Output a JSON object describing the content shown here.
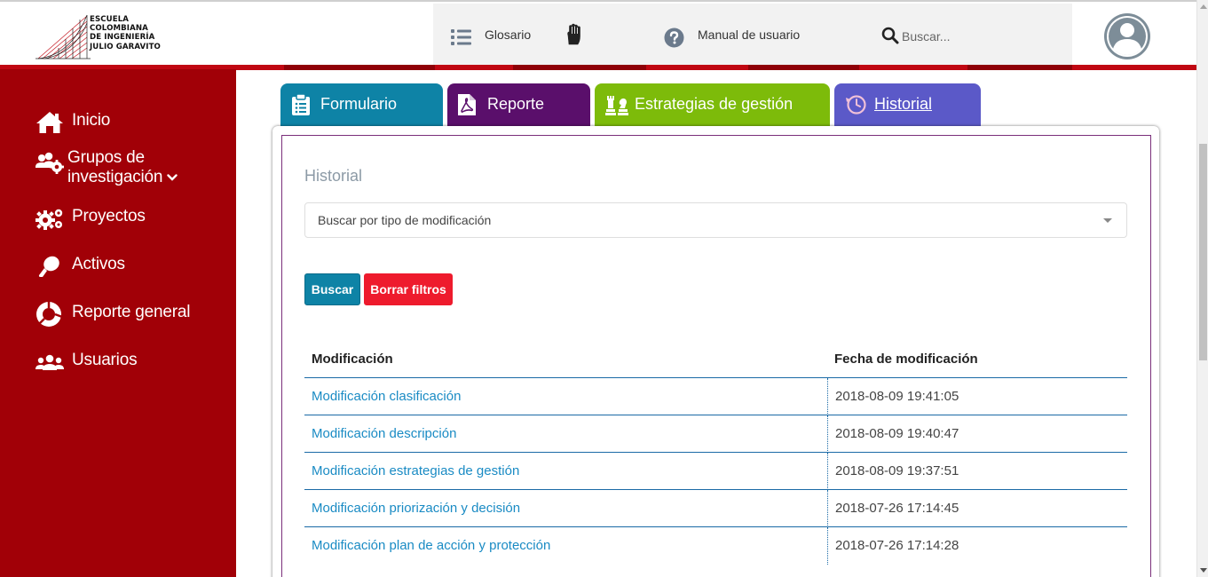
{
  "header": {
    "logo_lines": [
      "Escuela",
      "Colombiana",
      "de Ingeniería",
      "Julio Garavito"
    ],
    "glosario_label": "Glosario",
    "manual_label": "Manual de usuario",
    "search_placeholder": "Buscar..."
  },
  "sidebar": {
    "items": [
      {
        "label": "Inicio",
        "icon": "home-icon"
      },
      {
        "label": "Grupos de investigación",
        "label_line1": "Grupos de",
        "label_line2": "investigación",
        "icon": "users-gear-icon",
        "expandable": true
      },
      {
        "label": "Proyectos",
        "icon": "gears-icon"
      },
      {
        "label": "Activos",
        "icon": "asset-icon"
      },
      {
        "label": "Reporte general",
        "icon": "pie-chart-icon"
      },
      {
        "label": "Usuarios",
        "icon": "users-icon"
      }
    ]
  },
  "tabs": [
    {
      "label": "Formulario",
      "icon": "clipboard-icon",
      "color": "#0e83a6"
    },
    {
      "label": "Reporte",
      "icon": "pdf-icon",
      "color": "#5a0f6b"
    },
    {
      "label": "Estrategias de gestión",
      "icon": "chess-icon",
      "color": "#7dbb0a"
    },
    {
      "label": "Historial",
      "icon": "history-icon",
      "color": "#5b59c8",
      "active": true
    }
  ],
  "main": {
    "title": "Historial",
    "filter_placeholder": "Buscar por tipo de modificación",
    "buscar_label": "Buscar",
    "borrar_label": "Borrar filtros",
    "table": {
      "headers": [
        "Modificación",
        "Fecha de modificación"
      ],
      "rows": [
        {
          "modificacion": "Modificación clasificación",
          "fecha": "2018-08-09 19:41:05"
        },
        {
          "modificacion": "Modificación descripción",
          "fecha": "2018-08-09 19:40:47"
        },
        {
          "modificacion": "Modificación estrategias de gestión",
          "fecha": "2018-08-09 19:37:51"
        },
        {
          "modificacion": "Modificación priorización y decisión",
          "fecha": "2018-07-26 17:14:45"
        },
        {
          "modificacion": "Modificación plan de acción y protección",
          "fecha": "2018-07-26 17:14:28"
        }
      ]
    }
  },
  "colors": {
    "sidebar_bg": "#a10007",
    "accent_red": "#c00712",
    "link_blue": "#1a8bc4",
    "buscar_btn": "#0e83a6",
    "borrar_btn": "#ee1b2d"
  }
}
